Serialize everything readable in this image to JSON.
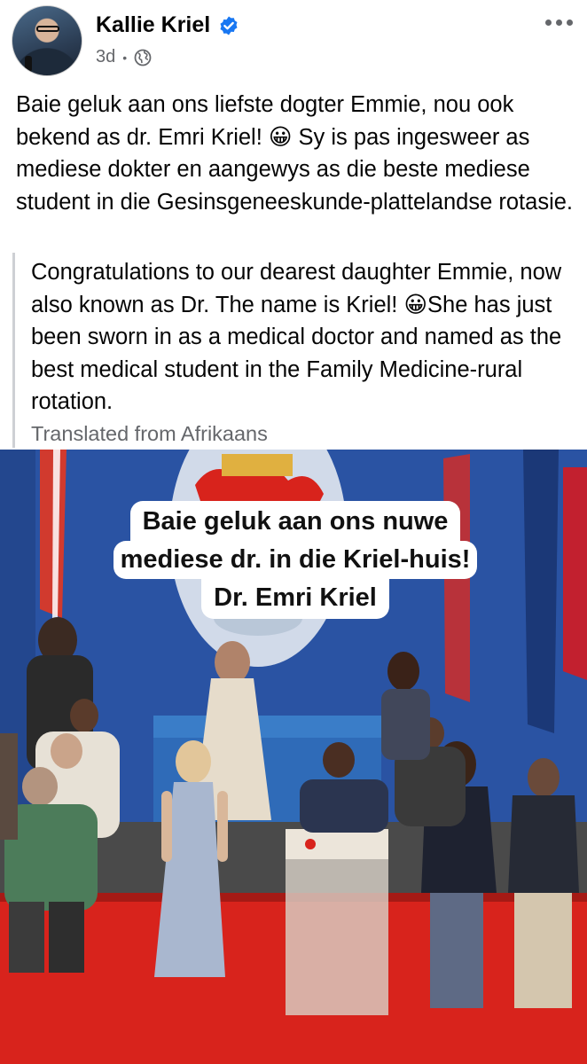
{
  "post": {
    "author": "Kallie Kriel",
    "time": "3d",
    "separator": "•",
    "text": "Baie geluk aan ons liefste dogter Emmie, nou ook bekend as dr. Emri Kriel! 😀 Sy is pas ingesweer as mediese dokter en aangewys as die beste mediese student in die Gesinsgeneeskunde-plattelandse rotasie.",
    "translation": "Congratulations to our dearest daughter Emmie, now also known as Dr. The name is Kriel! 😀She has just been sworn in as a medical doctor and named as the best medical student in the Family Medicine-rural rotation.",
    "translation_note": "Translated from Afrikaans"
  },
  "photo": {
    "caption_line1": "Baie geluk aan ons nuwe",
    "caption_line2": "mediese dr. in die Kriel-huis!",
    "caption_line3": "Dr. Emri Kriel"
  },
  "icons": {
    "verified": "verified-badge-icon",
    "audience": "globe-icon",
    "more": "more-options-icon"
  },
  "colors": {
    "verified_blue": "#1877f2",
    "secondary_text": "#65676b",
    "stage_red": "#d8231c",
    "backdrop_blue": "#2a55a8"
  }
}
